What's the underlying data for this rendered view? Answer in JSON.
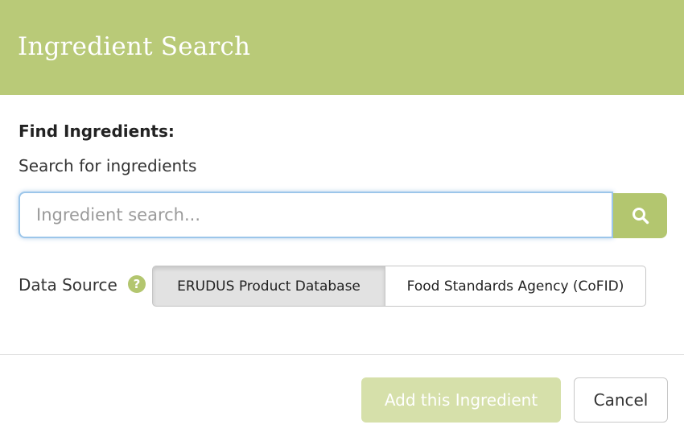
{
  "header": {
    "title": "Ingredient Search"
  },
  "find_section": {
    "label": "Find Ingredients:",
    "help_text": "Search for ingredients"
  },
  "search": {
    "placeholder": "Ingredient search...",
    "value": "",
    "button_icon": "search-icon"
  },
  "data_source": {
    "label": "Data Source",
    "help_icon": "question-circle-icon",
    "options": [
      {
        "label": "ERUDUS Product Database",
        "selected": true
      },
      {
        "label": "Food Standards Agency (CoFID)",
        "selected": false
      }
    ]
  },
  "footer": {
    "add_label": "Add this Ingredient",
    "add_disabled": true,
    "cancel_label": "Cancel"
  },
  "colors": {
    "accent": "#b9ca78",
    "button_green": "#b3c66f",
    "disabled_green": "#d6e0aa",
    "input_focus": "#9cc6ea"
  }
}
